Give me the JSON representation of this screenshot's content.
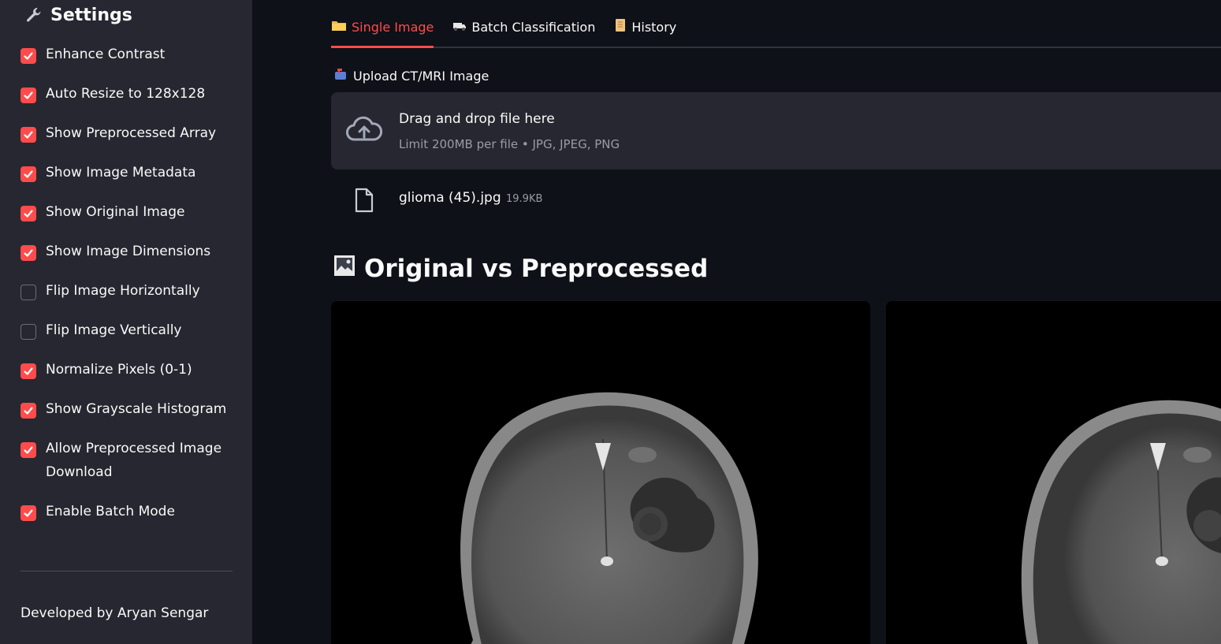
{
  "sidebar": {
    "title": "Settings",
    "title_icon": "wrench-icon",
    "options": [
      {
        "label": "Enhance Contrast",
        "checked": true
      },
      {
        "label": "Auto Resize to 128x128",
        "checked": true
      },
      {
        "label": "Show Preprocessed Array",
        "checked": true
      },
      {
        "label": "Show Image Metadata",
        "checked": true
      },
      {
        "label": "Show Original Image",
        "checked": true
      },
      {
        "label": "Show Image Dimensions",
        "checked": true
      },
      {
        "label": "Flip Image Horizontally",
        "checked": false
      },
      {
        "label": "Flip Image Vertically",
        "checked": false
      },
      {
        "label": "Normalize Pixels (0-1)",
        "checked": true
      },
      {
        "label": "Show Grayscale Histogram",
        "checked": true
      },
      {
        "label": "Allow Preprocessed Image Download",
        "checked": true
      },
      {
        "label": "Enable Batch Mode",
        "checked": true
      }
    ],
    "footer": "Developed by Aryan Sengar"
  },
  "tabs": [
    {
      "label": "Single Image",
      "icon": "folder-icon",
      "active": true
    },
    {
      "label": "Batch Classification",
      "icon": "truck-icon",
      "active": false
    },
    {
      "label": "History",
      "icon": "scroll-icon",
      "active": false
    }
  ],
  "uploader": {
    "label": "Upload CT/MRI Image",
    "icon": "mailbox-icon",
    "dropzone_title": "Drag and drop file here",
    "dropzone_hint": "Limit 200MB per file • JPG, JPEG, PNG",
    "file_name": "glioma (45).jpg",
    "file_size": "19.9KB"
  },
  "comparison": {
    "title": "Original vs Preprocessed",
    "icon": "image-frame-icon",
    "images": [
      "original-mri",
      "preprocessed-mri"
    ]
  },
  "colors": {
    "accent": "#ff4b4b",
    "sidebar_bg": "#262730",
    "main_bg": "#0e1117"
  }
}
